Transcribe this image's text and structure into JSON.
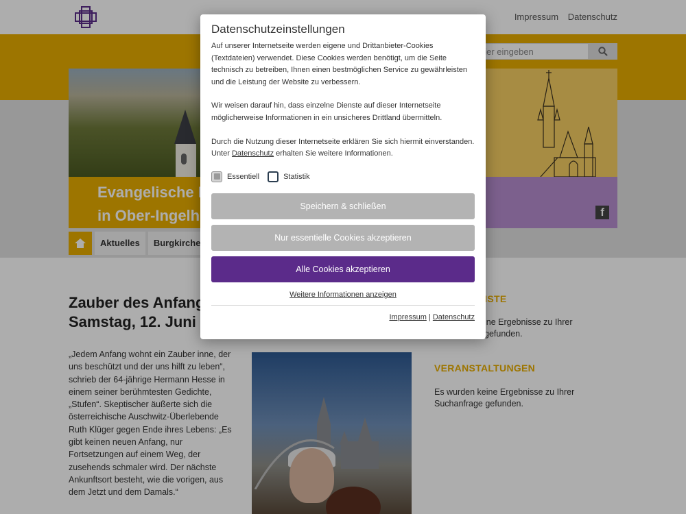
{
  "header": {
    "links": [
      "Impressum",
      "Datenschutz"
    ],
    "search_placeholder": "hier eingeben"
  },
  "hero": {
    "title_line1": "Evangelische B",
    "title_line2": "in Ober-Ingelhe"
  },
  "nav": {
    "items": [
      "Aktuelles",
      "Burgkirche"
    ]
  },
  "article": {
    "title_line1": "Zauber des Anfang",
    "title_line2": "Samstag, 12. Juni 2",
    "text": "„Jedem Anfang wohnt ein Zauber inne, der uns beschützt und der uns hilft zu leben“, schrieb der 64-jährige Hermann Hesse in einem seiner berühmtesten Gedichte, „Stufen“. Skeptischer äußerte sich die österreichische Auschwitz-Überlebende Ruth Klüger gegen Ende ihres Lebens: „Es gibt keinen neuen Anfang, nur Fortsetzungen auf einem Weg, der zusehends schmaler wird. Der nächste Ankunftsort besteht, wie die vorigen, aus dem Jetzt und dem Damals.“"
  },
  "sidebar": {
    "section1_heading": "NSTE",
    "section1_line1": "ine Ergebnisse zu Ihrer",
    "section1_line2": "gefunden.",
    "section2_heading": "VERANSTALTUNGEN",
    "section2_text": "Es wurden keine Ergebnisse zu Ihrer Suchanfrage gefunden."
  },
  "dialog": {
    "title": "Datenschutzeinstellungen",
    "para1": "Auf unserer Internetseite werden eigene und Drittanbieter-Cookies (Textdateien) verwendet. Diese Cookies werden benötigt, um die Seite technisch zu betreiben, Ihnen einen bestmöglichen Service zu gewährleisten und die Leistung der Website zu verbessern.",
    "para2": "Wir weisen darauf hin, dass einzelne Dienste auf dieser Internetseite möglicherweise Informationen in ein unsicheres Drittland übermitteln.",
    "para3_before": "Durch die Nutzung dieser Internetseite erklären Sie sich hiermit einverstanden. Unter ",
    "para3_link": "Datenschutz",
    "para3_after": " erhalten Sie weitere Informationen.",
    "check_essential": "Essentiell",
    "check_statistics": "Statistik",
    "btn_save": "Speichern & schließen",
    "btn_essential": "Nur essentielle Cookies akzeptieren",
    "btn_all": "Alle Cookies akzeptieren",
    "more_info": "Weitere Informationen anzeigen",
    "footer_impressum": "Impressum",
    "footer_sep": "|",
    "footer_datenschutz": "Datenschutz"
  },
  "colors": {
    "gold": "#e8ad00",
    "purple": "#5b2b8a",
    "button_grey": "#b3b3b3"
  }
}
